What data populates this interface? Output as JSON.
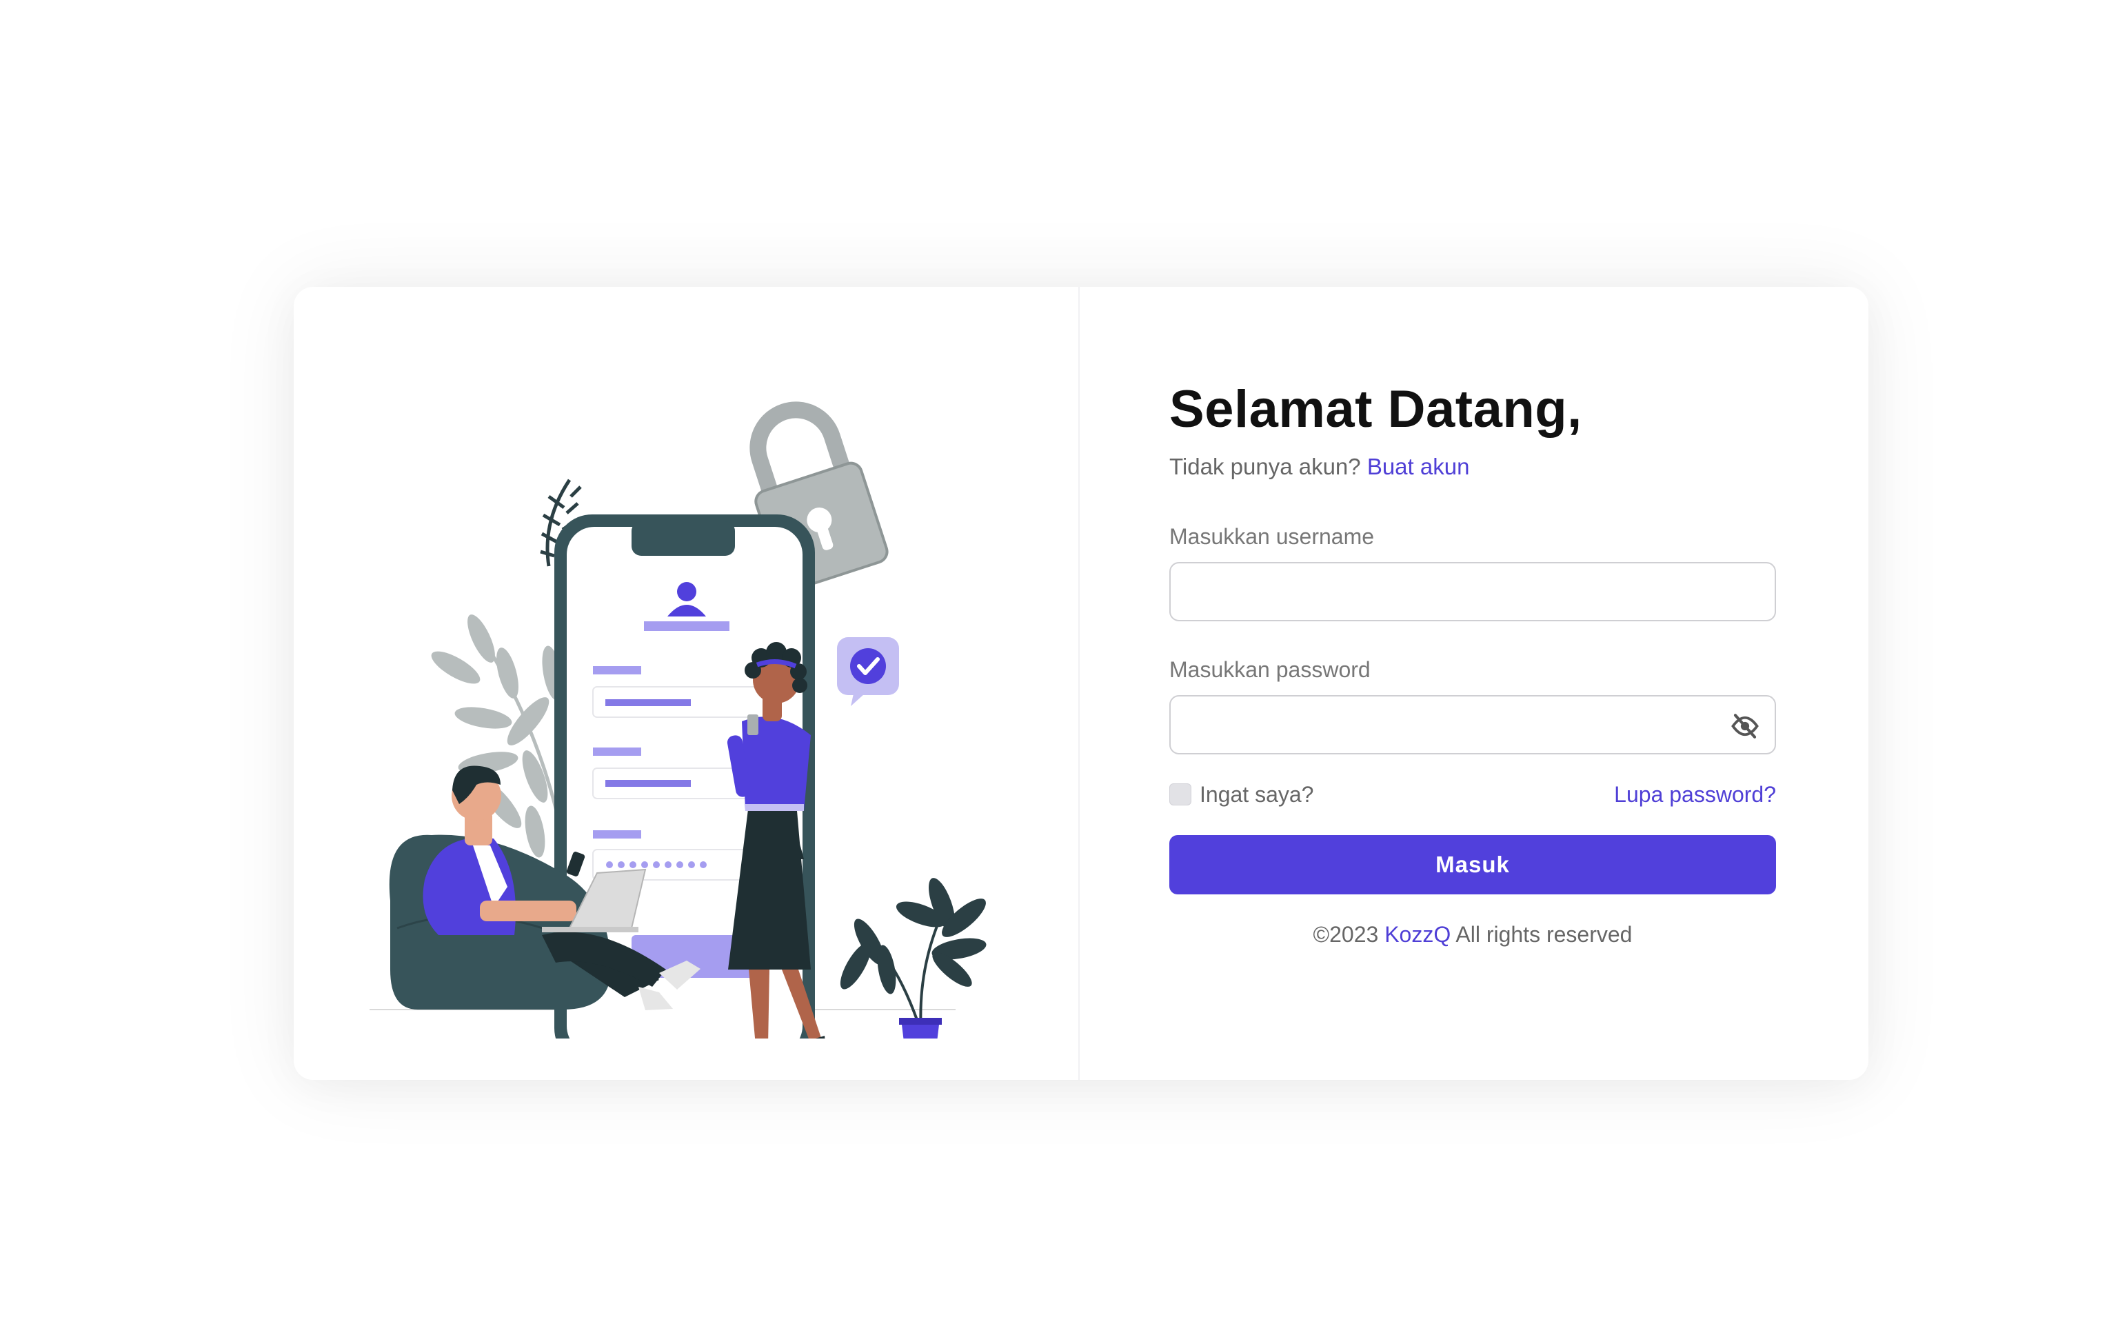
{
  "login": {
    "title": "Selamat Datang,",
    "no_account_text": "Tidak punya akun?",
    "create_account_link": "Buat akun",
    "username_label": "Masukkan username",
    "username_value": "",
    "password_label": "Masukkan password",
    "password_value": "",
    "remember_label": "Ingat saya?",
    "forgot_password_link": "Lupa password?",
    "submit_label": "Masuk",
    "footer_prefix": "©2023",
    "footer_brand": "KozzQ",
    "footer_suffix": "All rights reserved"
  },
  "icons": {
    "password_toggle": "eye-slash-icon",
    "illustration": "login-illustration"
  },
  "colors": {
    "accent": "#5140dc",
    "dark_teal": "#37545a",
    "light_purple": "#a59df0"
  }
}
